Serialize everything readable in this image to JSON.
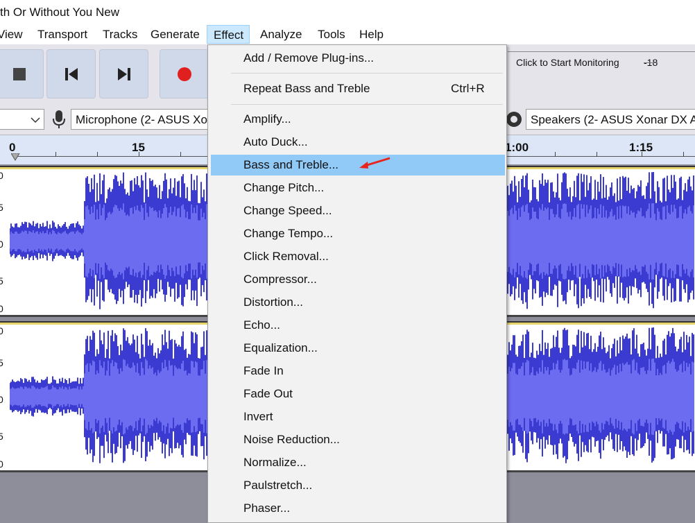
{
  "window": {
    "title": "th Or Without You New"
  },
  "menubar": {
    "items": [
      "View",
      "Transport",
      "Tracks",
      "Generate",
      "Effect",
      "Analyze",
      "Tools",
      "Help"
    ],
    "active": "Effect"
  },
  "toolbar": {
    "buttons": [
      "stop-icon",
      "skip-to-start-icon",
      "skip-to-end-icon",
      "record-icon"
    ],
    "monitor_label": "Click to Start Monitoring",
    "meter_label": "-18"
  },
  "devices": {
    "input_device": "Microphone (2- ASUS Xo",
    "output_device": "Speakers (2- ASUS Xonar DX A"
  },
  "ruler": {
    "labels": [
      "0",
      "15",
      "1:00",
      "1:15"
    ]
  },
  "tracks": {
    "scale_labels": [
      "0",
      "5",
      "0",
      "5",
      "0"
    ]
  },
  "effect_menu": {
    "add_remove_plugins": "Add / Remove Plug-ins...",
    "repeat_label": "Repeat Bass and Treble",
    "repeat_shortcut": "Ctrl+R",
    "items": [
      "Amplify...",
      "Auto Duck...",
      "Bass and Treble...",
      "Change Pitch...",
      "Change Speed...",
      "Change Tempo...",
      "Click Removal...",
      "Compressor...",
      "Distortion...",
      "Echo...",
      "Equalization...",
      "Fade In",
      "Fade Out",
      "Invert",
      "Noise Reduction...",
      "Normalize...",
      "Paulstretch...",
      "Phaser..."
    ],
    "highlighted": "Bass and Treble..."
  },
  "colors": {
    "waveform": "#3b3bd1",
    "waveform_rms": "#6c6cf0",
    "highlight": "#91c9f7",
    "annotation_arrow": "#e8251c",
    "record": "#e01f1f"
  }
}
